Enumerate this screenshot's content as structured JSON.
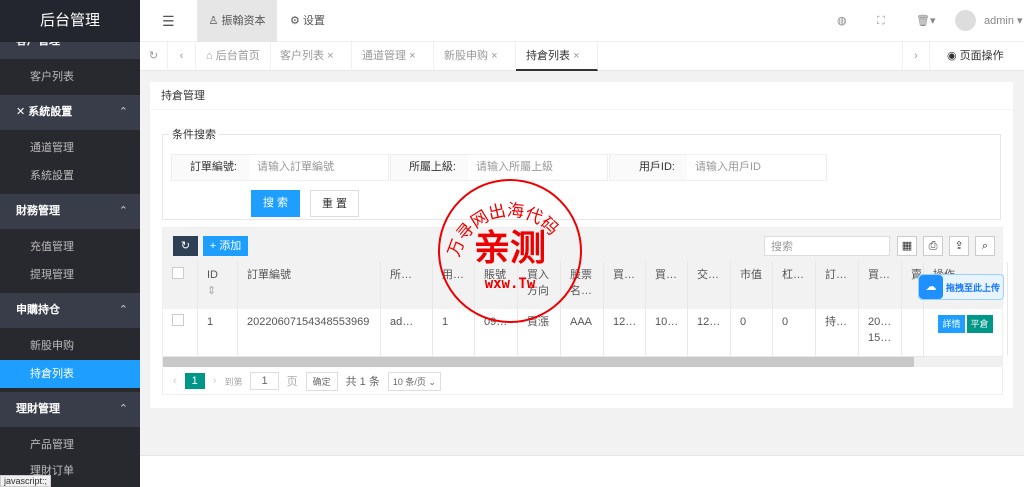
{
  "sidebar": {
    "logo": "后台管理",
    "groups": [
      {
        "label": "客户管理",
        "items": [
          "客户列表"
        ]
      },
      {
        "label": "系統設置",
        "items": [
          "通道管理",
          "系統設置"
        ]
      },
      {
        "label": "財務管理",
        "items": [
          "充值管理",
          "提現管理"
        ]
      },
      {
        "label": "申購持仓",
        "items": [
          "新股申购",
          "持倉列表"
        ]
      },
      {
        "label": "理財管理",
        "items": [
          "产品管理",
          "理財订单"
        ]
      }
    ],
    "active": "持倉列表"
  },
  "header": {
    "nav": [
      "振翰资本",
      "设置"
    ],
    "user": "admin"
  },
  "tabs": {
    "items": [
      "后台首页",
      "客户列表",
      "通道管理",
      "新股申购",
      "持倉列表"
    ],
    "page_ops": "页面操作"
  },
  "card": {
    "title": "持倉管理",
    "legend": "条件搜索",
    "fields": [
      {
        "label": "訂單編號:",
        "placeholder": "请输入訂單編號"
      },
      {
        "label": "所屬上級:",
        "placeholder": "请输入所屬上級"
      },
      {
        "label": "用戶ID:",
        "placeholder": "请输入用戶ID"
      }
    ],
    "search": "搜 索",
    "reset": "重 置"
  },
  "table": {
    "add": "+ 添加",
    "search_placeholder": "搜索",
    "columns": [
      "ID",
      "訂單編號",
      "所…",
      "用…",
      "賬號",
      "買入方向",
      "股票名…",
      "買…",
      "買…",
      "交…",
      "市值",
      "杠…",
      "訂…",
      "買…",
      "賣…",
      "操作"
    ],
    "rows": [
      {
        "cells": [
          "1",
          "20220607154348553969",
          "ad…",
          "1",
          "09…",
          "買漲",
          "AAA",
          "12…",
          "10…",
          "12…",
          "0",
          "0",
          "持…",
          "20… 15…",
          ""
        ],
        "actions": [
          "詳情",
          "平倉"
        ]
      }
    ]
  },
  "pager": {
    "current": "1",
    "goto": "到第",
    "page_input": "1",
    "page_unit": "页",
    "confirm": "确定",
    "total": "共 1 条",
    "per_page": "10 条/页"
  },
  "upload_widget": "拖拽至此上传",
  "stamp": {
    "ring": "万寻网出海代码",
    "center": "亲测",
    "url": "wxw.Tw"
  },
  "statusbar": "javascript:;",
  "colors": {
    "accent": "#1e9fff",
    "green": "#009688",
    "sidebar": "#28292f"
  }
}
